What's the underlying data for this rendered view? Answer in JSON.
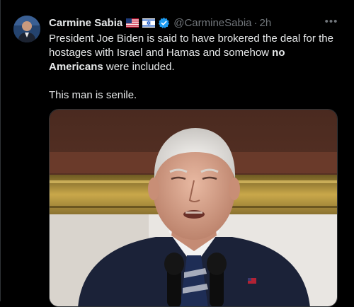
{
  "author": {
    "name": "Carmine Sabia",
    "handle": "@CarmineSabia",
    "time": "2h",
    "flags": [
      "us-flag-icon",
      "israel-flag-icon"
    ],
    "verified": true
  },
  "tweet": {
    "line1_pre": "President Joe Biden is said to have brokered the deal for the hostages with Israel and Hamas and somehow ",
    "line1_bold": "no Americans",
    "line1_post": " were included.",
    "line2": "This man is senile."
  },
  "media": {
    "type": "photo"
  },
  "colors": {
    "background": "#000000",
    "text": "#e7e9ea",
    "muted": "#71767b",
    "verified": "#1d9bf0"
  }
}
